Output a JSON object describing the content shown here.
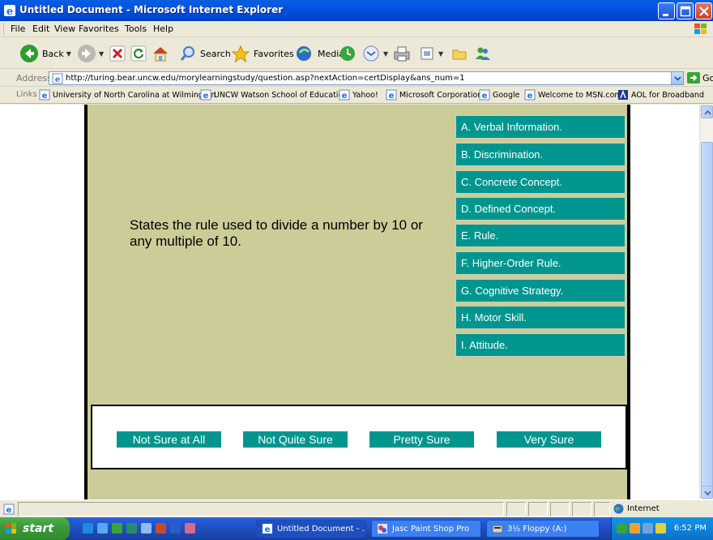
{
  "window": {
    "title": "Untitled Document - Microsoft Internet Explorer"
  },
  "menu": [
    "File",
    "Edit",
    "View",
    "Favorites",
    "Tools",
    "Help"
  ],
  "toolbar": {
    "back": "Back",
    "search": "Search",
    "favorites": "Favorites",
    "media": "Media"
  },
  "address": {
    "label": "Address",
    "url": "http://turing.bear.uncw.edu/morylearningstudy/question.asp?nextAction=certDisplay&ans_num=1",
    "go": "Go"
  },
  "links": {
    "label": "Links",
    "items": [
      "University of North Carolina at Wilmington",
      "UNCW Watson School of Education",
      "Yahoo!",
      "Microsoft Corporation",
      "Google",
      "Welcome to MSN.com",
      "AOL for Broadband"
    ]
  },
  "question": {
    "text": "States the rule used to divide a number by 10 or any multiple of 10."
  },
  "choices": [
    "A. Verbal Information.",
    "B. Discrimination.",
    "C. Concrete Concept.",
    "D. Defined Concept.",
    "E. Rule.",
    "F. Higher-Order Rule.",
    "G. Cognitive Strategy.",
    "H. Motor Skill.",
    "I. Attitude."
  ],
  "confidence": [
    "Not Sure at All",
    "Not Quite Sure",
    "Pretty Sure",
    "Very Sure"
  ],
  "status": {
    "zone": "Internet"
  },
  "taskbar": {
    "start": "start",
    "tasks": [
      "Untitled Document - ...",
      "Jasc Paint Shop Pro",
      "3½ Floppy (A:)"
    ],
    "clock": "6:52 PM"
  },
  "colors": {
    "panel_bg": "#CCCC99",
    "button_teal": "#00968F",
    "titlebar_blue": "#0054E3"
  }
}
